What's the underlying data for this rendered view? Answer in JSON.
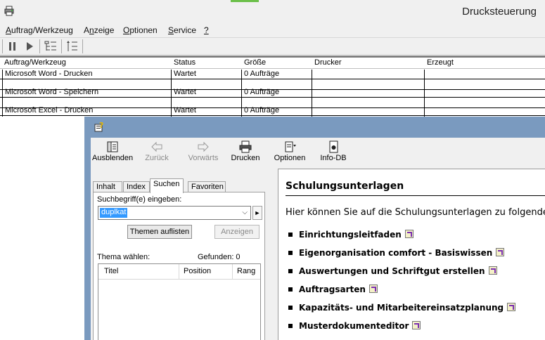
{
  "window": {
    "title": "Drucksteuerung"
  },
  "menu": {
    "items": [
      {
        "label": "Auftrag/Werkzeug",
        "mnemonic": "A"
      },
      {
        "label": "Anzeige",
        "mnemonic": "n"
      },
      {
        "label": "Optionen",
        "mnemonic": "O"
      },
      {
        "label": "Service",
        "mnemonic": "S"
      },
      {
        "label": "?",
        "mnemonic": "?"
      }
    ]
  },
  "toolbar": {
    "icons": [
      "pause-icon",
      "play-icon",
      "tree-details-icon",
      "tree-numbered-icon"
    ]
  },
  "table": {
    "columns": [
      "Auftrag/Werkzeug",
      "Status",
      "Größe",
      "Drucker",
      "Erzeugt"
    ],
    "rows": [
      {
        "job": "Microsoft Word - Drucken",
        "status": "Wartet",
        "size": "0 Aufträge",
        "printer": "",
        "created": ""
      },
      {
        "job": "Microsoft Word - Speichern",
        "status": "Wartet",
        "size": "0 Aufträge",
        "printer": "",
        "created": ""
      },
      {
        "job": "Microsoft Excel - Drucken",
        "status": "Wartet",
        "size": "0 Aufträge",
        "printer": "",
        "created": ""
      }
    ]
  },
  "help": {
    "toolbar": {
      "hide": "Ausblenden",
      "back": "Zurück",
      "forward": "Vorwärts",
      "print": "Drucken",
      "options": "Optionen",
      "infodb": "Info-DB"
    },
    "tabs": [
      "Inhalt",
      "Index",
      "Suchen",
      "Favoriten"
    ],
    "active_tab": "Suchen",
    "search": {
      "label": "Suchbegriff(e) eingeben:",
      "value": "duplkat",
      "list_topics_button": "Themen auflisten",
      "show_button": "Anzeigen",
      "choose_topic_label": "Thema wählen:",
      "found_label": "Gefunden: 0",
      "columns": [
        "Titel",
        "Position",
        "Rang"
      ]
    },
    "content": {
      "heading": "Schulungsunterlagen",
      "intro": "Hier können Sie auf die Schulungsunterlagen zu folgenden",
      "items": [
        "Einrichtungsleitfaden",
        "Eigenorganisation comfort - Basiswissen",
        "Auswertungen und Schriftgut erstellen",
        "Auftragsarten",
        "Kapazitäts- und Mitarbeitereinsatzplanung",
        "Musterdokumenteditor"
      ]
    }
  }
}
